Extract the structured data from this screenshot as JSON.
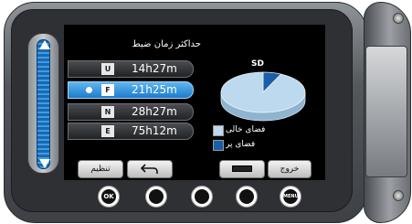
{
  "screen": {
    "title": "حداکثر زمان ضبط",
    "rows": [
      {
        "icon": "U",
        "value": "14h27m",
        "selected": false
      },
      {
        "icon": "F",
        "value": "21h25m",
        "selected": true
      },
      {
        "icon": "N",
        "value": "28h27m",
        "selected": false
      },
      {
        "icon": "E",
        "value": "75h12m",
        "selected": false
      }
    ],
    "chart_label": "SD",
    "legend": {
      "free": "فضای خالی",
      "used": "فضای پر"
    }
  },
  "buttons": {
    "settings": "تنظیم",
    "back_icon": "back-arrow-icon",
    "blank_icon": "blank-bar-icon",
    "exit": "خروج",
    "ok": "OK",
    "menu": "MENU"
  },
  "colors": {
    "selected_row": "#2a8bd4",
    "pie_light": "#bcd9ee",
    "pie_dark": "#1a5da8",
    "scroll_blue": "#2a87d4"
  },
  "chart_data": {
    "type": "pie",
    "title": "SD",
    "categories": [
      "فضای خالی",
      "فضای پر"
    ],
    "values": [
      93,
      7
    ]
  }
}
